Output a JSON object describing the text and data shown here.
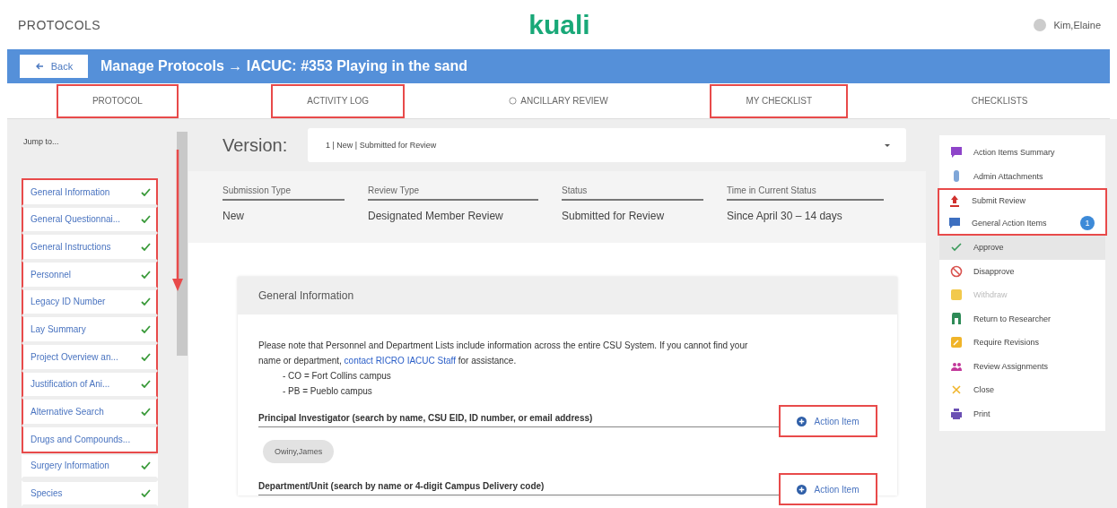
{
  "header": {
    "app_name": "PROTOCOLS",
    "logo": "kuali",
    "user": "Kim,Elaine"
  },
  "title_bar": {
    "back": "Back",
    "title": "Manage Protocols → IACUC: #353 Playing in the sand"
  },
  "tabs": [
    {
      "label": "PROTOCOL",
      "selected": false,
      "highlighted": true,
      "kind": "plain"
    },
    {
      "label": "ACTIVITY LOG",
      "selected": false,
      "highlighted": true,
      "kind": "plain"
    },
    {
      "label": "ANCILLARY REVIEW",
      "selected": false,
      "highlighted": false,
      "kind": "info"
    },
    {
      "label": "MY CHECKLIST",
      "selected": false,
      "highlighted": true,
      "kind": "plain"
    },
    {
      "label": "CHECKLISTS",
      "selected": false,
      "highlighted": false,
      "kind": "plain"
    }
  ],
  "sidebar": {
    "heading": "Jump to...",
    "annotation_arrow": true,
    "items": [
      {
        "label": "General Information",
        "checked": true,
        "highlighted": true
      },
      {
        "label": "General Questionnai...",
        "checked": true,
        "highlighted": true
      },
      {
        "label": "General Instructions",
        "checked": true,
        "highlighted": true
      },
      {
        "label": "Personnel",
        "checked": true,
        "highlighted": true
      },
      {
        "label": "Legacy ID Number",
        "checked": true,
        "highlighted": true
      },
      {
        "label": "Lay Summary",
        "checked": true,
        "highlighted": true
      },
      {
        "label": "Project Overview an...",
        "checked": true,
        "highlighted": true
      },
      {
        "label": "Justification of Ani...",
        "checked": true,
        "highlighted": true
      },
      {
        "label": "Alternative Search",
        "checked": true,
        "highlighted": true
      },
      {
        "label": "Drugs and Compounds...",
        "checked": false,
        "highlighted": true
      },
      {
        "label": "Surgery Information",
        "checked": true,
        "highlighted": false
      },
      {
        "label": "Species",
        "checked": true,
        "highlighted": false
      }
    ]
  },
  "version": {
    "label": "Version:",
    "value": "1 | New | Submitted for Review"
  },
  "summary": [
    {
      "label": "Submission Type",
      "value": "New"
    },
    {
      "label": "Review Type",
      "value": "Designated Member Review"
    },
    {
      "label": "Status",
      "value": "Submitted for Review"
    },
    {
      "label": "Time in Current Status",
      "value": "Since April 30 – 14 days"
    }
  ],
  "card": {
    "title": "General Information",
    "note": "Please note that Personnel and Department Lists include information across the entire CSU System. If you cannot find your name or department, ",
    "note_link": "contact RICRO IACUC Staff",
    "note_end": " for assistance.",
    "bullets": [
      "- CO = Fort Collins campus",
      "- PB = Pueblo campus"
    ],
    "fields": [
      {
        "label": "Principal Investigator (search by name, CSU EID, ID number, or email address)",
        "action": "Action Item",
        "highlighted": true,
        "chips": [
          "Owiny,James"
        ]
      },
      {
        "label": "Department/Unit (search by name or 4-digit Campus Delivery code)",
        "action": "Action Item",
        "highlighted": true
      }
    ]
  },
  "actions": [
    {
      "label": "Action Items Summary",
      "kind": "comment",
      "color": "#8e44c9",
      "selected": false,
      "disabled": false,
      "highlighted": false
    },
    {
      "label": "Admin Attachments",
      "kind": "clip",
      "color": "#7fa6d8",
      "selected": false,
      "disabled": false,
      "highlighted": false
    },
    {
      "label": "Submit Review",
      "kind": "upload",
      "color": "#d0312d",
      "selected": false,
      "disabled": false,
      "highlighted": true
    },
    {
      "label": "General Action Items",
      "kind": "comment",
      "color": "#3d6fc0",
      "selected": false,
      "disabled": false,
      "highlighted": true,
      "badge": "1"
    },
    {
      "label": "Approve",
      "kind": "check",
      "color": "#3a9a5b",
      "selected": true,
      "disabled": false,
      "highlighted": false
    },
    {
      "label": "Disapprove",
      "kind": "ban",
      "color": "#d9534f",
      "selected": false,
      "disabled": false,
      "highlighted": false
    },
    {
      "label": "Withdraw",
      "kind": "square",
      "color": "#f2c94c",
      "selected": false,
      "disabled": true,
      "highlighted": false
    },
    {
      "label": "Return to Researcher",
      "kind": "door",
      "color": "#2e8b57",
      "selected": false,
      "disabled": false,
      "highlighted": false
    },
    {
      "label": "Require Revisions",
      "kind": "edit",
      "color": "#f0b429",
      "selected": false,
      "disabled": false,
      "highlighted": false
    },
    {
      "label": "Review Assignments",
      "kind": "people",
      "color": "#c2389a",
      "selected": false,
      "disabled": false,
      "highlighted": false
    },
    {
      "label": "Close",
      "kind": "x",
      "color": "#f0b429",
      "selected": false,
      "disabled": false,
      "highlighted": false
    },
    {
      "label": "Print",
      "kind": "printer",
      "color": "#6a4fb3",
      "selected": false,
      "disabled": false,
      "highlighted": false
    }
  ]
}
